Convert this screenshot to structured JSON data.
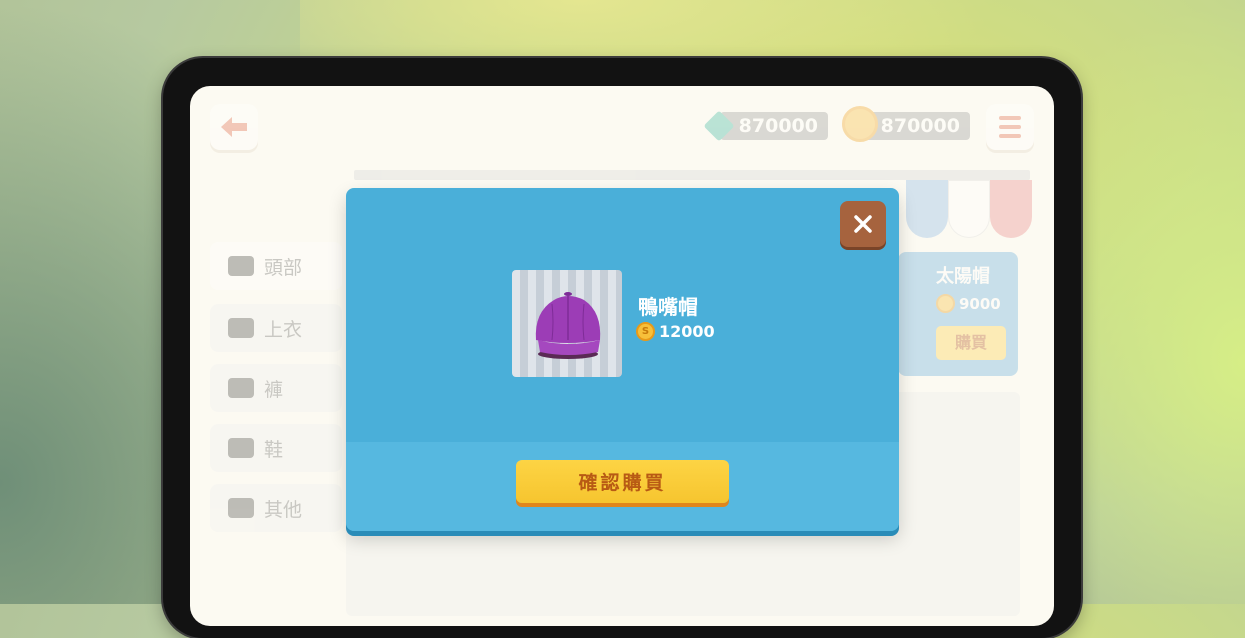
{
  "header": {
    "gems": "870000",
    "coins": "870000"
  },
  "categories": [
    {
      "label": "頭部"
    },
    {
      "label": "上衣"
    },
    {
      "label": "褲"
    },
    {
      "label": "鞋"
    },
    {
      "label": "其他"
    }
  ],
  "background_item": {
    "name": "太陽帽",
    "price": "9000",
    "buy_label": "購買"
  },
  "modal": {
    "item_name": "鴨嘴帽",
    "price": "12000",
    "coin_symbol": "S",
    "confirm_label": "確認購買",
    "close_icon": "close-icon"
  },
  "colors": {
    "modal_bg": "#4aafd9",
    "close_button": "#a6633e",
    "confirm_button": "#fdd444",
    "cap": "#9c3db6"
  }
}
